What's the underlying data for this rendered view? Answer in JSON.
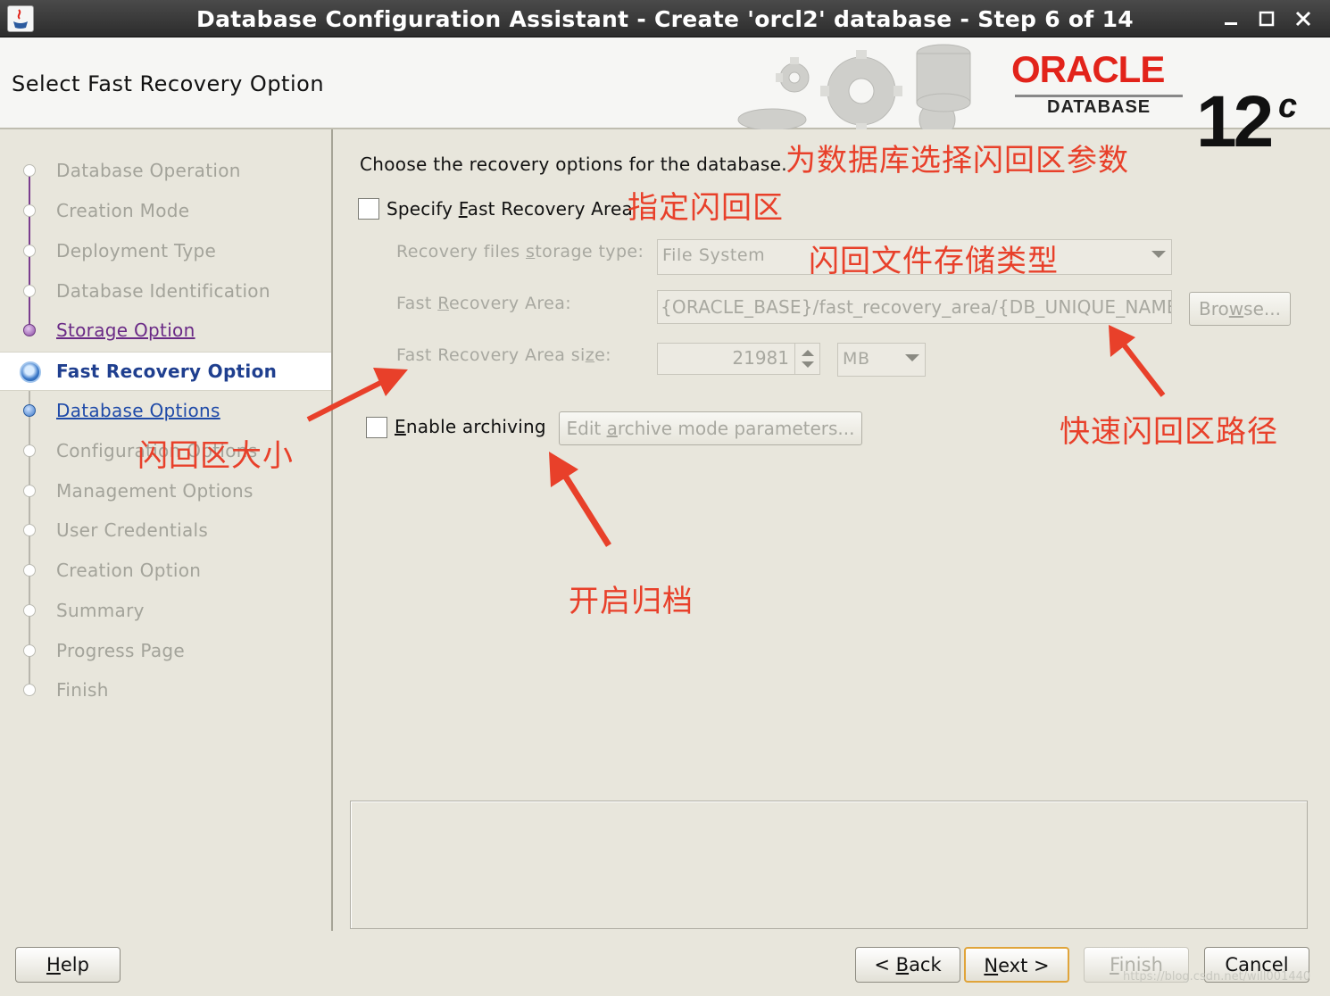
{
  "window": {
    "title": "Database Configuration Assistant - Create 'orcl2' database - Step 6 of 14"
  },
  "header": {
    "page_title": "Select Fast Recovery Option",
    "logo_word": "ORACLE",
    "logo_sub": "DATABASE",
    "version": "12",
    "version_sup": "c"
  },
  "nav": {
    "items": [
      {
        "label": "Database Operation",
        "state": "disabled"
      },
      {
        "label": "Creation Mode",
        "state": "disabled"
      },
      {
        "label": "Deployment Type",
        "state": "disabled"
      },
      {
        "label": "Database Identification",
        "state": "disabled"
      },
      {
        "label": "Storage Option",
        "state": "visited"
      },
      {
        "label": "Fast Recovery Option",
        "state": "current"
      },
      {
        "label": "Database Options",
        "state": "link"
      },
      {
        "label": "Configuration Options",
        "state": "disabled"
      },
      {
        "label": "Management Options",
        "state": "disabled"
      },
      {
        "label": "User Credentials",
        "state": "disabled"
      },
      {
        "label": "Creation Option",
        "state": "disabled"
      },
      {
        "label": "Summary",
        "state": "disabled"
      },
      {
        "label": "Progress Page",
        "state": "disabled"
      },
      {
        "label": "Finish",
        "state": "disabled"
      }
    ]
  },
  "content": {
    "instruction": "Choose the recovery options for the database.",
    "specify_fra": {
      "pre": "Specify ",
      "mn": "F",
      "post": "ast Recovery Area",
      "checked": false
    },
    "storage_type": {
      "pre": "Recovery files ",
      "mn": "s",
      "post": "torage type:",
      "value": "File System"
    },
    "fra_path": {
      "pre": "Fast ",
      "mn": "R",
      "post": "ecovery Area:",
      "value": "{ORACLE_BASE}/fast_recovery_area/{DB_UNIQUE_NAME}"
    },
    "browse": {
      "pre": "Bro",
      "mn": "w",
      "post": "se..."
    },
    "fra_size": {
      "label": "Fast Recovery Area si",
      "mn": "z",
      "post": "e:",
      "value": "21981",
      "unit": "MB"
    },
    "archiving": {
      "pre": "",
      "mn": "E",
      "post": "nable archiving",
      "checked": false
    },
    "edit_archive": {
      "pre": "Edit ",
      "mn": "a",
      "post": "rchive mode parameters..."
    }
  },
  "footer": {
    "help": {
      "mn": "H",
      "post": "elp"
    },
    "back": {
      "pre": "< ",
      "mn": "B",
      "post": "ack"
    },
    "next": {
      "mn": "N",
      "post": "ext >"
    },
    "finish": {
      "mn": "F",
      "post": "inish"
    },
    "cancel": "Cancel"
  },
  "annotations": {
    "instruction_note": "为数据库选择闪回区参数",
    "specify_note": "指定闪回区",
    "storage_note": "闪回文件存储类型",
    "size_note": "闪回区大小",
    "path_note": "快速闪回区路径",
    "archive_note": "开启归档",
    "color": "#e8402a"
  },
  "watermark": "https://blog.csdn.net/will001440"
}
